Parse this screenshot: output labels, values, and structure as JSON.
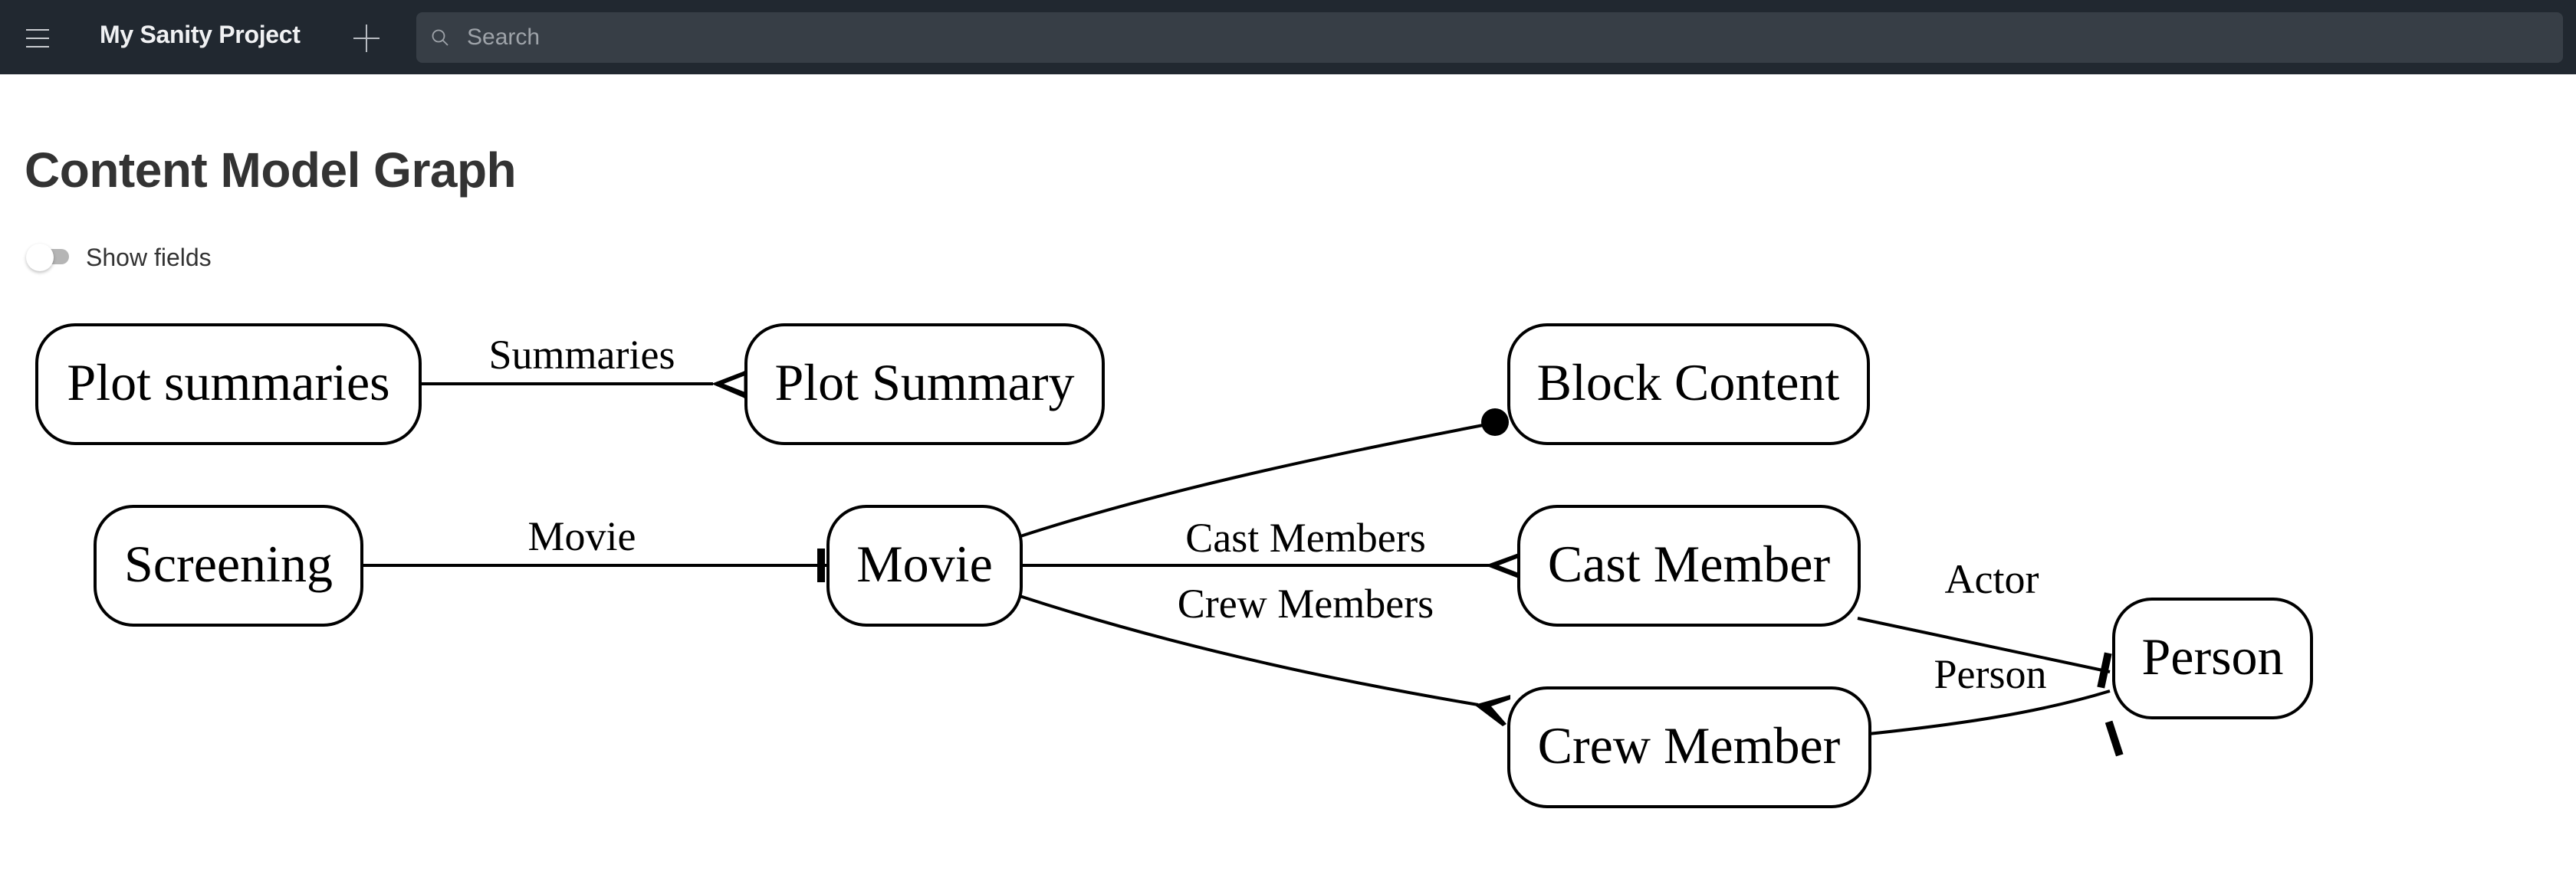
{
  "navbar": {
    "menu_icon": "hamburger-menu-icon",
    "project_title": "My Sanity Project",
    "add_icon": "plus-icon",
    "search_icon": "search-icon",
    "search_placeholder": "Search",
    "search_value": ""
  },
  "page": {
    "title": "Content Model Graph",
    "show_fields_label": "Show fields",
    "show_fields_enabled": false
  },
  "colors": {
    "navbar_bg": "#212830",
    "search_bg": "#373e46",
    "title_text": "#333333",
    "graph_stroke": "#000000"
  },
  "graph": {
    "nodes": [
      {
        "id": "plot_summaries",
        "label": "Plot summaries"
      },
      {
        "id": "plot_summary",
        "label": "Plot Summary"
      },
      {
        "id": "block_content",
        "label": "Block Content"
      },
      {
        "id": "screening",
        "label": "Screening"
      },
      {
        "id": "movie",
        "label": "Movie"
      },
      {
        "id": "cast_member",
        "label": "Cast Member"
      },
      {
        "id": "crew_member",
        "label": "Crew Member"
      },
      {
        "id": "person",
        "label": "Person"
      }
    ],
    "edges": [
      {
        "from": "plot_summaries",
        "to": "plot_summary",
        "label": "Summaries",
        "end_marker": "crows-foot"
      },
      {
        "from": "screening",
        "to": "movie",
        "label": "Movie",
        "end_marker": "tee"
      },
      {
        "from": "movie",
        "to": "block_content",
        "label": "",
        "end_marker": "dot"
      },
      {
        "from": "movie",
        "to": "cast_member",
        "label": "Cast Members",
        "end_marker": "crows-foot"
      },
      {
        "from": "movie",
        "to": "crew_member",
        "label": "Crew Members",
        "end_marker": "crows-foot"
      },
      {
        "from": "cast_member",
        "to": "person",
        "label": "Actor",
        "end_marker": "tee"
      },
      {
        "from": "crew_member",
        "to": "person",
        "label": "Person",
        "end_marker": "tee"
      }
    ]
  }
}
